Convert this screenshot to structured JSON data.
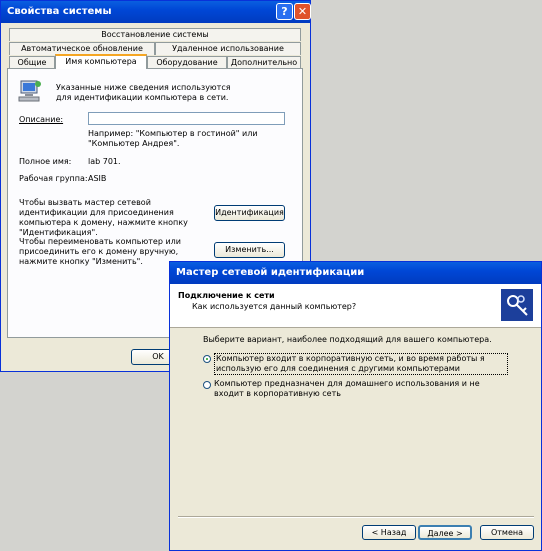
{
  "sysprops": {
    "title": "Свойства системы",
    "help_glyph": "?",
    "close_glyph": "✕",
    "tabs_row1": [
      "Восстановление системы"
    ],
    "tabs_row2": [
      "Автоматическое обновление",
      "Удаленное использование"
    ],
    "tabs_row3": [
      "Общие",
      "Имя компьютера",
      "Оборудование",
      "Дополнительно"
    ],
    "intro_text": "Указанные ниже сведения используются для идентификации компьютера в сети.",
    "description_label": "Описание:",
    "description_value": "",
    "description_hint": "Например: \"Компьютер в гостиной\" или \"Компьютер Андрея\".",
    "fullname_label": "Полное имя:",
    "fullname_value": "lab 701.",
    "workgroup_label": "Рабочая группа:",
    "workgroup_value": "ASIB",
    "netid_text": "Чтобы вызвать мастер сетевой идентификации для присоединения компьютера к домену, нажмите кнопку \"Идентификация\".",
    "netid_button": "Идентификация",
    "rename_text": "Чтобы переименовать компьютер или присоединить его к домену вручную, нажмите кнопку \"Изменить\".",
    "rename_button": "Изменить...",
    "ok_button": "OK"
  },
  "wizard": {
    "title": "Мастер сетевой идентификации",
    "header_title": "Подключение к сети",
    "header_subtitle": "Как используется данный компьютер?",
    "prompt": "Выберите вариант, наиболее подходящий для вашего компьютера.",
    "option1": "Компьютер входит в корпоративную сеть, и во время работы я использую его для соединения с другими компьютерами",
    "option2": "Компьютер предназначен для домашнего использования и не входит в корпоративную сеть",
    "option1_selected": true,
    "back_button": "< Назад",
    "next_button": "Далее >",
    "cancel_button": "Отмена"
  },
  "icons": {
    "computer": "computer-network-icon",
    "keys": "keys-icon"
  }
}
